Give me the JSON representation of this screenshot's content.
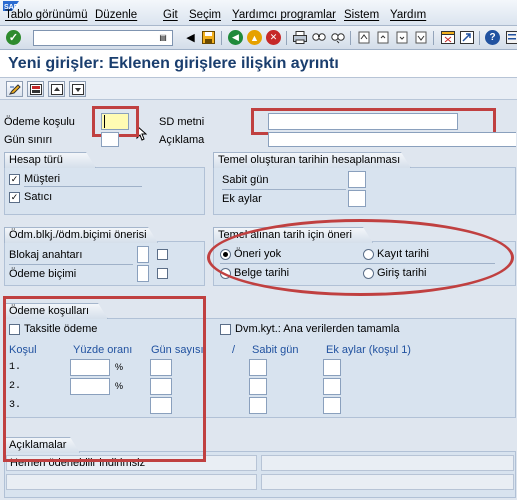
{
  "menu": [
    "Tablo görünümü",
    "Düzenle",
    "Git",
    "Seçim",
    "Yardımcı programlar",
    "Sistem",
    "Yardım"
  ],
  "page_title": "Yeni girişler: Eklenen girişlere ilişkin ayrıntı",
  "header": {
    "payment_term_label": "Ödeme koşulu",
    "day_limit_label": "Gün sınırı",
    "sd_text_label": "SD metni",
    "description_label": "Açıklama"
  },
  "account_type": {
    "title": "Hesap türü",
    "customer_label": "Müşteri",
    "vendor_label": "Satıcı",
    "customer_checked": true,
    "vendor_checked": true
  },
  "baseline_calc": {
    "title": "Temel oluşturan tarihin hesaplanması",
    "fixed_day_label": "Sabit gün",
    "extra_months_label": "Ek aylar"
  },
  "payment_block": {
    "title": "Ödm.blkj./ödm.biçimi önerisi",
    "block_key_label": "Blokaj anahtarı",
    "payment_method_label": "Ödeme biçimi"
  },
  "baseline_default": {
    "title": "Temel alınan tarih için öneri",
    "options": [
      "Öneri yok",
      "Kayıt tarihi",
      "Belge tarihi",
      "Giriş tarihi"
    ],
    "selected": "Öneri yok"
  },
  "payment_terms": {
    "title": "Ödeme koşulları",
    "installment_label": "Taksitle ödeme",
    "master_data_label": "Dvm.kyt.: Ana verilerden tamamla",
    "col_term": "Koşul",
    "col_percent": "Yüzde oranı",
    "col_days": "Gün sayısı",
    "col_slash": "/",
    "col_fixed_day": "Sabit gün",
    "col_extra_months": "Ek aylar (koşul 1)",
    "rows": [
      "1.",
      "2.",
      "3."
    ],
    "percent_sign": "%"
  },
  "explanations": {
    "title": "Açıklamalar",
    "line1": "Hemen ödenebilir indirimsiz"
  }
}
